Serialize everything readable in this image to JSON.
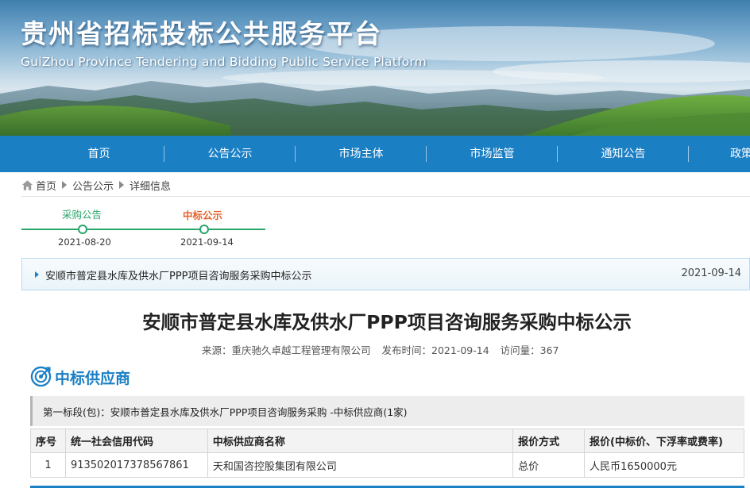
{
  "header": {
    "title": "贵州省招标投标公共服务平台",
    "subtitle": "GuiZhou Province Tendering and Bidding Public Service Platform"
  },
  "nav": {
    "items": [
      {
        "label": "首页"
      },
      {
        "label": "公告公示"
      },
      {
        "label": "市场主体"
      },
      {
        "label": "市场监管"
      },
      {
        "label": "通知公告"
      },
      {
        "label": "政策"
      }
    ]
  },
  "breadcrumb": {
    "items": [
      {
        "label": "首页",
        "icon": "home-icon"
      },
      {
        "label": "公告公示"
      },
      {
        "label": "详细信息"
      }
    ]
  },
  "timeline": {
    "steps": [
      {
        "label": "采购公告",
        "date": "2021-08-20",
        "color": "#2aa66a",
        "active": false
      },
      {
        "label": "中标公示",
        "date": "2021-09-14",
        "color": "#e8622a",
        "active": true
      }
    ]
  },
  "notice": {
    "title": "安顺市普定县水库及供水厂PPP项目咨询服务采购中标公示",
    "date": "2021-09-14"
  },
  "article": {
    "title": "安顺市普定县水库及供水厂PPP项目咨询服务采购中标公示",
    "source": "来源：重庆驰久卓越工程管理有限公司",
    "publish_time": "发布时间：2021-09-14",
    "views": "访问量：367"
  },
  "section": {
    "title": "中标供应商",
    "icon": "target-icon"
  },
  "lot": {
    "text": "第一标段(包)：安顺市普定县水库及供水厂PPP项目咨询服务采购  -中标供应商(1家)"
  },
  "table": {
    "headers": [
      "序号",
      "统一社会信用代码",
      "中标供应商名称",
      "报价方式",
      "报价(中标价、下浮率或费率)"
    ],
    "rows": [
      [
        "1",
        "913502017378567861",
        "天和国咨控股集团有限公司",
        "总价",
        "人民币1650000元"
      ]
    ]
  },
  "colors": {
    "primary": "#1b7fc4",
    "timeline_done": "#2aa66a",
    "timeline_active": "#e8622a"
  }
}
